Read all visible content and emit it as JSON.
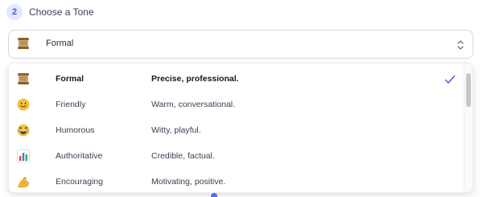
{
  "step": {
    "number": "2",
    "title": "Choose a Tone"
  },
  "select": {
    "value": "Formal",
    "icon": "scroll-icon"
  },
  "options": [
    {
      "name": "Formal",
      "description": "Precise, professional.",
      "icon": "scroll-icon",
      "selected": true
    },
    {
      "name": "Friendly",
      "description": "Warm, conversational.",
      "icon": "smiley-icon",
      "selected": false
    },
    {
      "name": "Humorous",
      "description": "Witty, playful.",
      "icon": "laughing-face-icon",
      "selected": false
    },
    {
      "name": "Authoritative",
      "description": "Credible, factual.",
      "icon": "bar-chart-icon",
      "selected": false
    },
    {
      "name": "Encouraging",
      "description": "Motivating, positive.",
      "icon": "flexed-biceps-icon",
      "selected": false
    }
  ],
  "colors": {
    "accent": "#4657d6",
    "badge_bg": "#e3e8ff",
    "border": "#d6d9de"
  }
}
